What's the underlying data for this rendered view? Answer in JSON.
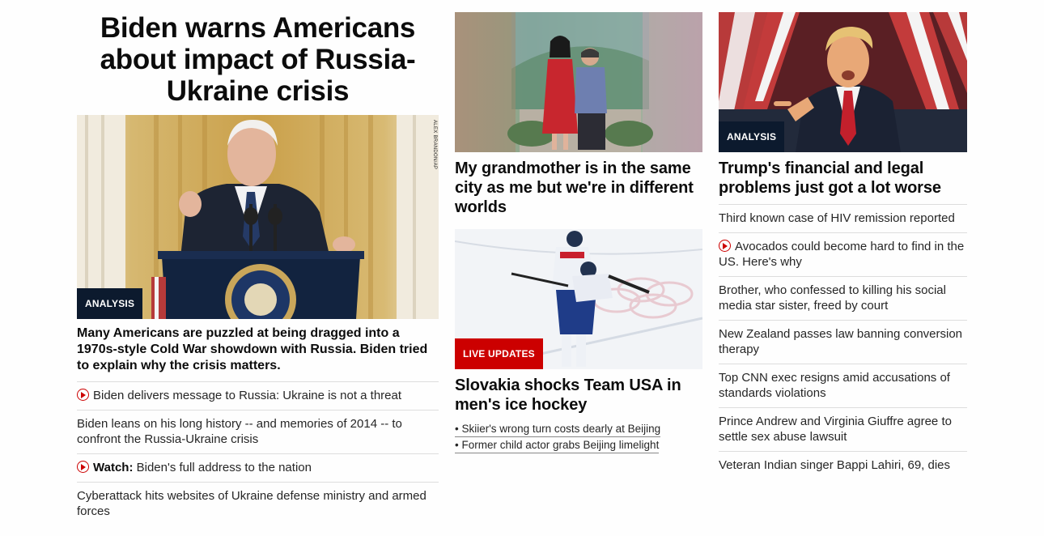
{
  "column1": {
    "title": "Biden warns Americans about impact of Russia-Ukraine crisis",
    "image": {
      "tag": "ANALYSIS",
      "credit": "ALEX BRANDON/AP"
    },
    "lead": "Many Americans are puzzled at being dragged into a 1970s-style Cold War showdown with Russia. Biden tried to explain why the crisis matters.",
    "items": [
      {
        "video": true,
        "prefix": "",
        "text": "Biden delivers message to Russia: Ukraine is not a threat"
      },
      {
        "video": false,
        "prefix": "",
        "text": "Biden leans on his long history -- and memories of 2014 -- to confront the Russia-Ukraine crisis"
      },
      {
        "video": true,
        "prefix": "Watch:",
        "text": " Biden's full address to the nation"
      },
      {
        "video": false,
        "prefix": "",
        "text": "Cyberattack hits websites of Ukraine defense ministry and armed forces"
      }
    ]
  },
  "column2": {
    "story1": {
      "headline": "My grandmother is in the same city as me but we're in different worlds"
    },
    "story2": {
      "tag": "LIVE UPDATES",
      "headline": "Slovakia shocks Team USA in men's ice hockey",
      "links": [
        "• Skiier's wrong turn costs dearly at Beijing",
        "• Former child actor grabs Beijing limelight"
      ]
    }
  },
  "column3": {
    "tag": "ANALYSIS",
    "headline": "Trump's financial and legal problems just got a lot worse",
    "items": [
      {
        "video": false,
        "text": "Third known case of HIV remission reported"
      },
      {
        "video": true,
        "text": "Avocados could become hard to find in the US. Here's why"
      },
      {
        "video": false,
        "text": "Brother, who confessed to killing his social media star sister, freed by court"
      },
      {
        "video": false,
        "text": "New Zealand passes law banning conversion therapy"
      },
      {
        "video": false,
        "text": "Top CNN exec resigns amid accusations of standards violations"
      },
      {
        "video": false,
        "text": "Prince Andrew and Virginia Giuffre agree to settle sex abuse lawsuit"
      },
      {
        "video": false,
        "text": "Veteran Indian singer Bappi Lahiri, 69, dies"
      }
    ]
  },
  "colors": {
    "tag_navy": "#0c1a2e",
    "tag_red": "#cc0000",
    "play_icon": "#cc0000"
  },
  "icons": {
    "video": "play-circle-icon"
  }
}
